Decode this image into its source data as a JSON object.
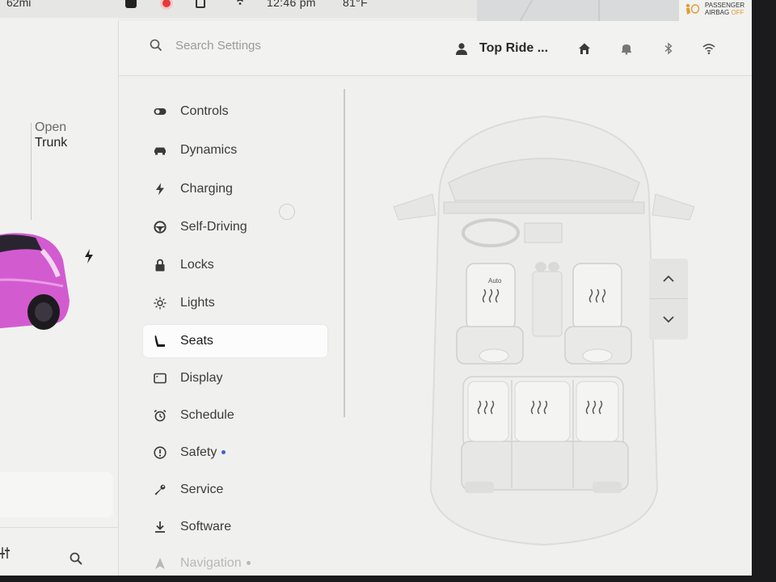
{
  "status_bar": {
    "range": "62mi",
    "time": "12:46 pm",
    "temperature": "81°F",
    "airbag_line1": "PASSENGER",
    "airbag_line2": "AIRBAG",
    "airbag_state": "OFF"
  },
  "car_panel": {
    "trunk_open": "Open",
    "trunk_word": "Trunk",
    "car_color": "#d35bd0"
  },
  "top_bar": {
    "search_placeholder": "Search Settings",
    "profile_name": "Top Ride ..."
  },
  "menu": {
    "items": [
      {
        "label": "Controls",
        "icon": "toggle-icon"
      },
      {
        "label": "Dynamics",
        "icon": "car-icon"
      },
      {
        "label": "Charging",
        "icon": "bolt-icon"
      },
      {
        "label": "Self-Driving",
        "icon": "steering-wheel-icon"
      },
      {
        "label": "Locks",
        "icon": "lock-icon"
      },
      {
        "label": "Lights",
        "icon": "sun-icon"
      },
      {
        "label": "Seats",
        "icon": "seat-icon",
        "active": true
      },
      {
        "label": "Display",
        "icon": "display-icon"
      },
      {
        "label": "Schedule",
        "icon": "alarm-clock-icon"
      },
      {
        "label": "Safety",
        "icon": "alert-circle-icon",
        "badge": true
      },
      {
        "label": "Service",
        "icon": "wrench-icon"
      },
      {
        "label": "Software",
        "icon": "download-icon"
      },
      {
        "label": "Navigation",
        "icon": "navigation-arrow-icon",
        "badge": true
      }
    ]
  },
  "seats": {
    "driver_heat_label": "Auto"
  },
  "colors": {
    "accent_dot": "#3a63c9",
    "airbag_off": "#e39a2d",
    "record": "#e23a3a"
  }
}
